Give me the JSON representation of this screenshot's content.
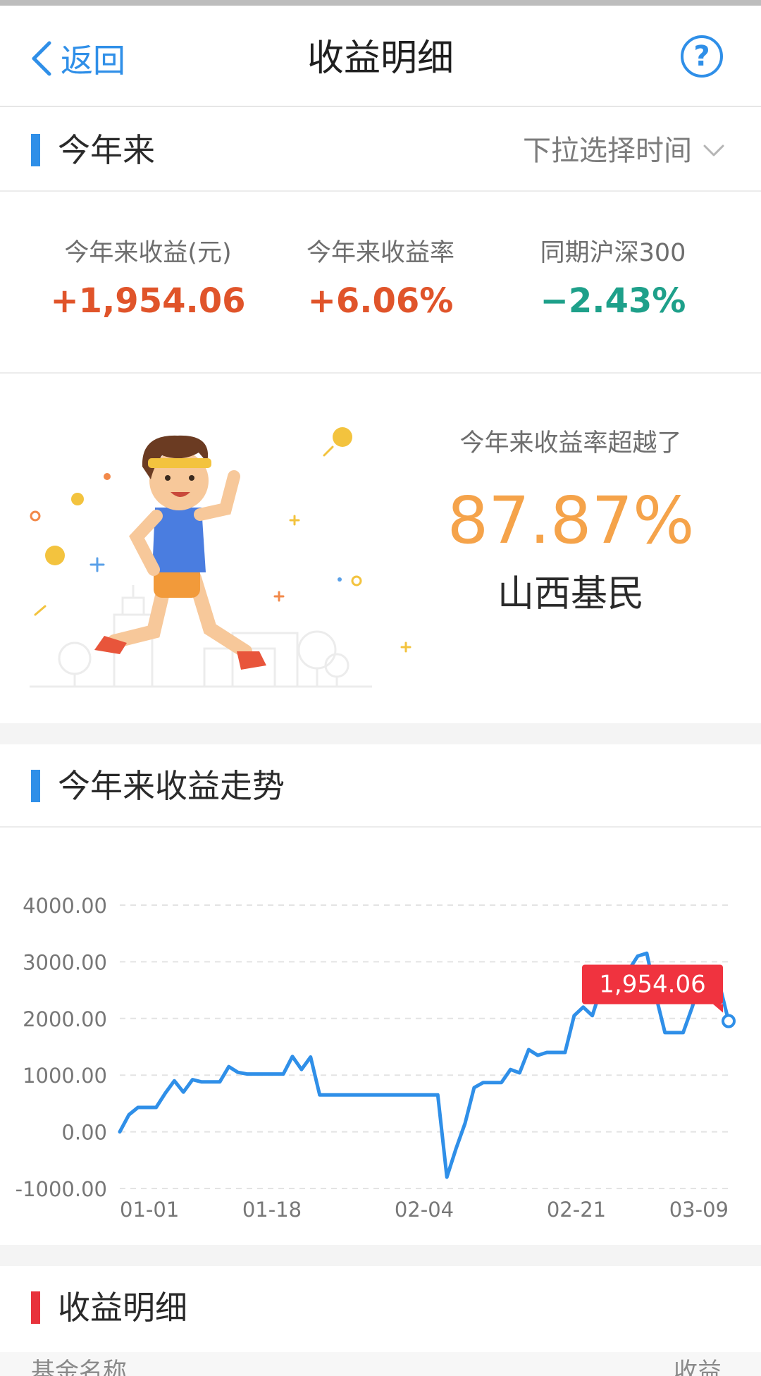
{
  "header": {
    "back_label": "返回",
    "title": "收益明细",
    "help_label": "?"
  },
  "period": {
    "title": "今年来",
    "selector_label": "下拉选择时间"
  },
  "stats": [
    {
      "label": "今年来收益(元)",
      "value": "+1,954.06"
    },
    {
      "label": "今年来收益率",
      "value": "+6.06%"
    },
    {
      "label": "同期沪深300",
      "value": "−2.43%"
    }
  ],
  "rank": {
    "label": "今年来收益率超越了",
    "value": "87.87%",
    "group": "山西基民"
  },
  "trend": {
    "title": "今年来收益走势"
  },
  "chart_data": {
    "type": "line",
    "ylim": [
      -1000,
      4000
    ],
    "yticks": [
      "4000.00",
      "3000.00",
      "2000.00",
      "1000.00",
      "0.00",
      "-1000.00"
    ],
    "xticks": [
      "01-01",
      "01-18",
      "02-04",
      "02-21",
      "03-09"
    ],
    "line_color": "#2f8fe8",
    "grid": true,
    "series": [
      {
        "values": [
          0,
          300,
          430,
          430,
          430,
          680,
          900,
          700,
          920,
          880,
          880,
          880,
          1150,
          1050,
          1020,
          1020,
          1020,
          1020,
          1020,
          1330,
          1100,
          1320,
          650,
          650,
          650,
          650,
          650,
          650,
          650,
          650,
          650,
          650,
          650,
          650,
          650,
          650,
          -800,
          -300,
          150,
          780,
          870,
          870,
          870,
          1100,
          1040,
          1450,
          1350,
          1400,
          1400,
          1400,
          2050,
          2200,
          2050,
          2550,
          2850,
          2850,
          2850,
          3100,
          3150,
          2400,
          1750,
          1750,
          1750,
          2200,
          2700,
          2850,
          2600,
          1954.06
        ]
      }
    ],
    "last_value_label": "1,954.06"
  },
  "detail": {
    "title": "收益明细",
    "col_name": "基金名称",
    "col_income": "收益"
  },
  "colors": {
    "accent_blue": "#2f8fe8",
    "gain_red": "#e0542a",
    "loss_green": "#1ea08a",
    "rank_orange": "#f5a34a",
    "tooltip_red": "#f0333f"
  }
}
